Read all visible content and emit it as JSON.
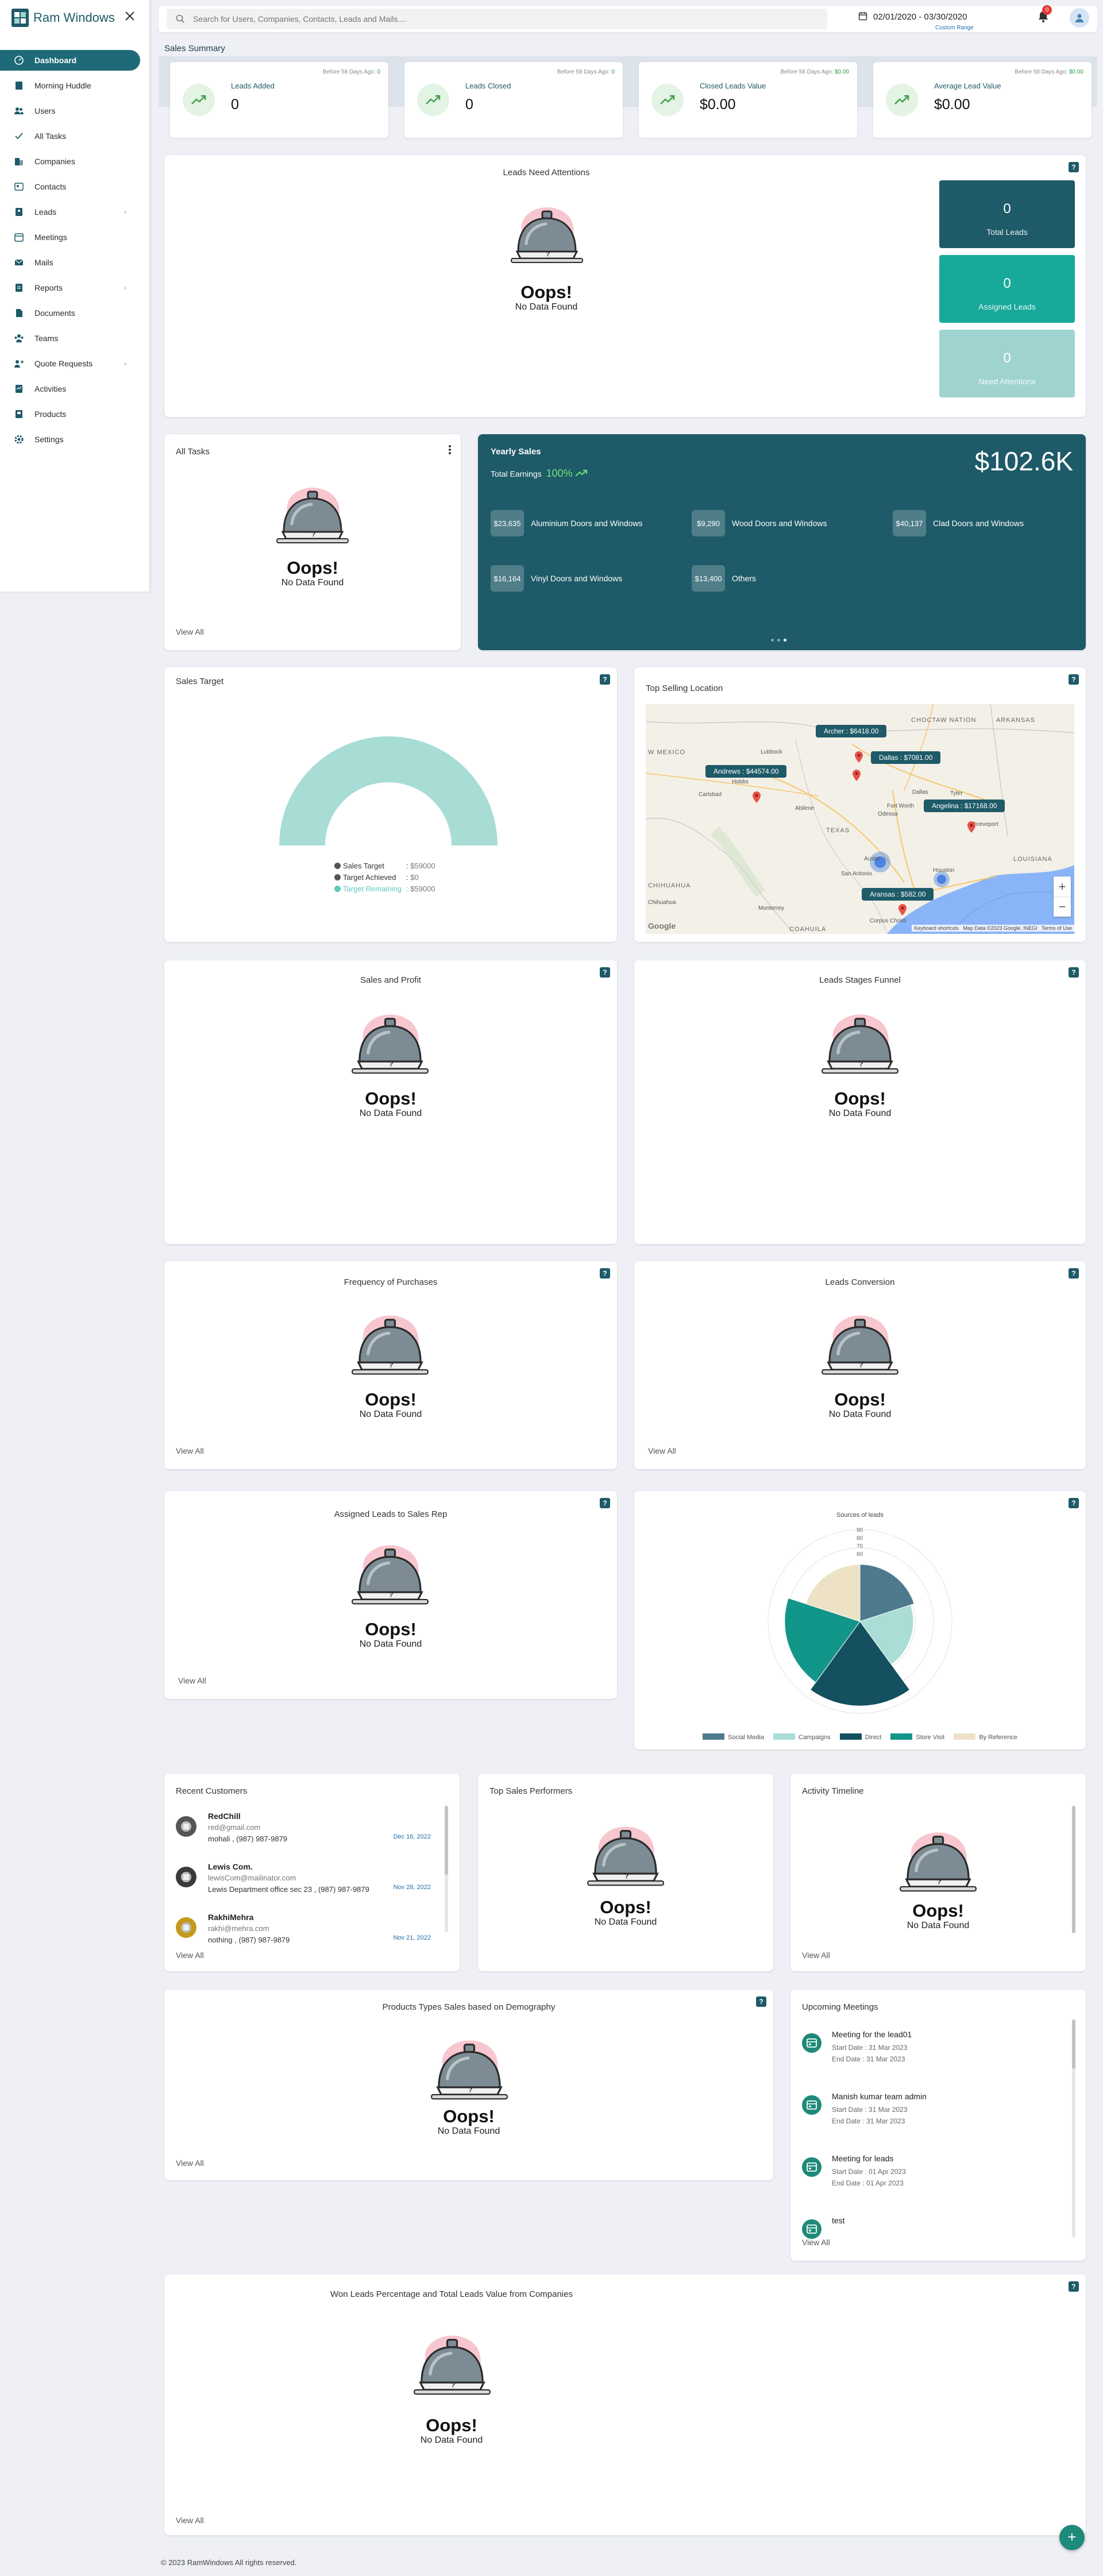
{
  "app": {
    "name": "Ram Windows"
  },
  "sidebar": {
    "items": [
      {
        "label": "Dashboard",
        "icon": "dashboard-icon",
        "active": true
      },
      {
        "label": "Morning Huddle",
        "icon": "book-icon"
      },
      {
        "label": "Users",
        "icon": "users-icon"
      },
      {
        "label": "All Tasks",
        "icon": "check-icon"
      },
      {
        "label": "Companies",
        "icon": "building-icon"
      },
      {
        "label": "Contacts",
        "icon": "contact-card-icon"
      },
      {
        "label": "Leads",
        "icon": "lead-icon",
        "chevron": true
      },
      {
        "label": "Meetings",
        "icon": "calendar-icon"
      },
      {
        "label": "Mails",
        "icon": "mail-icon"
      },
      {
        "label": "Reports",
        "icon": "report-icon",
        "chevron": true
      },
      {
        "label": "Documents",
        "icon": "document-icon"
      },
      {
        "label": "Teams",
        "icon": "team-icon"
      },
      {
        "label": "Quote Requests",
        "icon": "quote-icon",
        "chevron": true
      },
      {
        "label": "Activities",
        "icon": "activity-icon"
      },
      {
        "label": "Products",
        "icon": "product-icon"
      },
      {
        "label": "Settings",
        "icon": "gear-icon"
      }
    ]
  },
  "topbar": {
    "search_placeholder": "Search for Users, Companies, Contacts, Leads and Mails....",
    "date_range": "02/01/2020 - 03/30/2020",
    "range_label": "Custom Range",
    "notification_count": "0"
  },
  "summary": {
    "title": "Sales Summary",
    "cards": [
      {
        "label": "Leads Added",
        "value": "0",
        "before_text": "Before 58 Days Ago:",
        "before_value": "0"
      },
      {
        "label": "Leads Closed",
        "value": "0",
        "before_text": "Before 58 Days Ago:",
        "before_value": "0"
      },
      {
        "label": "Closed Leads Value",
        "value": "$0.00",
        "before_text": "Before 58 Days Ago:",
        "before_value": "$0.00"
      },
      {
        "label": "Average Lead Value",
        "value": "$0.00",
        "before_text": "Before 58 Days Ago:",
        "before_value": "$0.00"
      }
    ]
  },
  "empty": {
    "title": "Oops!",
    "subtitle": "No Data Found",
    "view_all": "View All"
  },
  "leads_attention": {
    "title": "Leads Need Attentions",
    "stats": [
      {
        "value": "0",
        "label": "Total Leads",
        "color": "#1e5a68"
      },
      {
        "value": "0",
        "label": "Assigned Leads",
        "color": "#17a99a"
      },
      {
        "value": "0",
        "label": "Need Attentions",
        "color": "#9fd3cf"
      }
    ]
  },
  "all_tasks": {
    "title": "All Tasks"
  },
  "yearly_sales": {
    "title": "Yearly Sales",
    "total_label": "Total Earnings",
    "total_pct": "100%",
    "amount": "$102.6K",
    "items": [
      {
        "value": "$23,635",
        "label": "Aluminium Doors and Windows"
      },
      {
        "value": "$9,290",
        "label": "Wood Doors and Windows"
      },
      {
        "value": "$40,137",
        "label": "Clad Doors and Windows"
      },
      {
        "value": "$16,164",
        "label": "Vinyl Doors and Windows"
      },
      {
        "value": "$13,400",
        "label": "Others"
      }
    ]
  },
  "sales_target": {
    "title": "Sales Target",
    "target_fraction": 1.0,
    "legend": [
      {
        "label": "Sales Target",
        "value": "$59000",
        "color": "#555555"
      },
      {
        "label": "Target Achieved",
        "value": "$0",
        "color": "#555555"
      },
      {
        "label": "Target Remaining",
        "value": "$59000",
        "color": "#5fc8c0"
      }
    ]
  },
  "top_selling": {
    "title": "Top Selling Location",
    "pins": [
      {
        "label": "Archer : $6418.00"
      },
      {
        "label": "Dallas : $7081.00"
      },
      {
        "label": "Andrews : $44574.00"
      },
      {
        "label": "Angelina : $17168.00"
      },
      {
        "label": "Aransas : $582.00"
      }
    ],
    "map_labels": [
      "CHOCTAW NATION",
      "ARKANSAS",
      "Lubbock",
      "W MEXICO",
      "Dallas",
      "Fort Worth",
      "Carlsbad",
      "Odessa",
      "Shreveport",
      "TEXAS",
      "Austin",
      "LOUISIANA",
      "CHIHUAHUA",
      "San Antonio",
      "Houston",
      "Chihuahua",
      "Corpus Christi",
      "COAHUILA",
      "Monterrey",
      "Hobbs",
      "Tyler",
      "Abilene"
    ],
    "footer": [
      "Keyboard shortcuts",
      "Map Data ©2023 Google, INEGI",
      "Terms of Use"
    ],
    "google": "Google"
  },
  "sales_profit": {
    "title": "Sales and Profit"
  },
  "leads_funnel": {
    "title": "Leads Stages Funnel"
  },
  "freq_purchases": {
    "title": "Frequency of Purchases"
  },
  "leads_conversion": {
    "title": "Leads Conversion"
  },
  "assigned_leads": {
    "title": "Assigned Leads to Sales Rep"
  },
  "sources": {
    "chart_data": {
      "type": "pie",
      "title": "Sources of leads",
      "radial_ticks": [
        90,
        80,
        70,
        60
      ],
      "series": [
        {
          "name": "Social Media",
          "color": "#4d7a8c",
          "value": 20,
          "radius": 0.62
        },
        {
          "name": "Campaigns",
          "color": "#a9ddd6",
          "value": 20,
          "radius": 0.58
        },
        {
          "name": "Direct",
          "color": "#14505f",
          "value": 20,
          "radius": 0.92
        },
        {
          "name": "Store Visit",
          "color": "#12968a",
          "value": 20,
          "radius": 0.82
        },
        {
          "name": "By Reference",
          "color": "#ede2c6",
          "value": 20,
          "radius": 0.62
        }
      ]
    }
  },
  "recent_customers": {
    "title": "Recent Customers",
    "items": [
      {
        "name": "RedChill",
        "email": "red@gmail.com",
        "address": "mohali , (987) 987-9879",
        "date": "Dec 16, 2022",
        "avatar_color": "#555555"
      },
      {
        "name": "Lewis Com.",
        "email": "lewisCom@mailinator.com",
        "address": "Lewis Department office sec 23 , (987) 987-9879",
        "date": "Nov 28, 2022",
        "avatar_color": "#3a3a3a"
      },
      {
        "name": "RakhiMehra",
        "email": "rakhi@mehra.com",
        "address": "nothing , (987) 987-9879",
        "date": "Nov 21, 2022",
        "avatar_color": "#c49a1c"
      }
    ]
  },
  "top_performers": {
    "title": "Top Sales Performers"
  },
  "activity_timeline": {
    "title": "Activity Timeline"
  },
  "demography": {
    "title": "Products Types Sales based on Demography"
  },
  "upcoming_meetings": {
    "title": "Upcoming Meetings",
    "items": [
      {
        "title": "Meeting for the lead01",
        "start": "Start Date : 31 Mar 2023",
        "end": "End Date : 31 Mar 2023"
      },
      {
        "title": "Manish kumar team admin",
        "start": "Start Date : 31 Mar 2023",
        "end": "End Date : 31 Mar 2023"
      },
      {
        "title": "Meeting for leads",
        "start": "Start Date : 01 Apr 2023",
        "end": "End Date : 01 Apr 2023"
      },
      {
        "title": "test",
        "start": "",
        "end": ""
      }
    ]
  },
  "won_leads": {
    "title": "Won Leads Percentage and Total Leads Value from Companies"
  },
  "footer": {
    "copyright": "© 2023 RamWindows All rights reserved."
  },
  "colors": {
    "primary": "#1e5a68",
    "accent": "#17a99a",
    "background": "#eef0f5"
  }
}
